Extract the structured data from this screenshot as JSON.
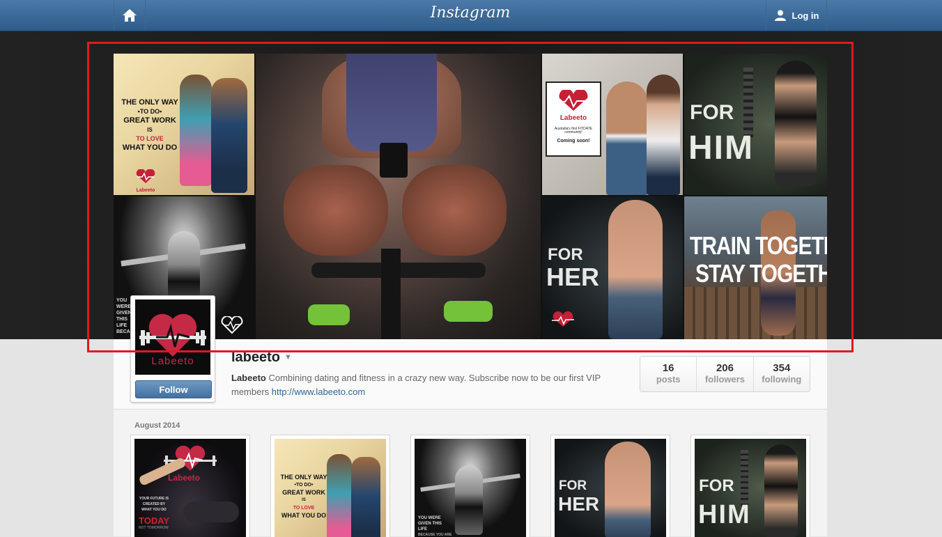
{
  "topbar": {
    "logo": "Instagram",
    "login_label": "Log in"
  },
  "mosaic": {
    "tile1": {
      "lines": [
        "THE ONLY WAY",
        "•TO DO•",
        "GREAT WORK",
        "IS",
        "TO LOVE",
        "WHAT YOU DO"
      ],
      "brand": "Labeeto"
    },
    "tile4": {
      "line1": "FOR",
      "line2": "HIM"
    },
    "tile5": {
      "line1": "FOR",
      "line2": "HER"
    },
    "tile6": {
      "line1": "TRAIN TOGETHER",
      "line2": "STAY TOGETHER"
    },
    "tile3": {
      "brand": "Labeeto",
      "tag": "Australia's first FITDATE community!",
      "soon": "Coming soon!"
    },
    "tile7": {
      "text": "YOU WERE GIVEN THIS LIFE BECAUSE YOU ARE STRONG"
    }
  },
  "profile": {
    "username": "labeeto",
    "avatar_brand": "Labeeto",
    "follow_label": "Follow",
    "bio_name": "Labeeto",
    "bio_text": " Combining dating and fitness in a crazy new way. Subscribe now to be our first VIP members ",
    "bio_link": "http://www.labeeto.com",
    "stats": [
      {
        "num": "16",
        "label": "posts"
      },
      {
        "num": "206",
        "label": "followers"
      },
      {
        "num": "354",
        "label": "following"
      }
    ]
  },
  "feed": {
    "month": "August 2014",
    "thumbs": [
      {
        "brand": "Labeeto",
        "quote": "YOUR FUTURE IS CREATED BY WHAT YOU DO",
        "today": "TODAY",
        "nt": "NOT TOMORROW"
      },
      {
        "lines": [
          "THE ONLY WAY",
          "•TO DO•",
          "GREAT WORK",
          "IS",
          "TO LOVE",
          "WHAT YOU DO"
        ]
      },
      {
        "text": "YOU WERE GIVEN THIS LIFE",
        "text2": "BECAUSE YOU ARE"
      },
      {
        "line1": "FOR",
        "line2": "HER"
      },
      {
        "line1": "FOR",
        "line2": "HIM"
      }
    ]
  },
  "colors": {
    "topbar": "#3a6894",
    "highlight": "#e0191e",
    "follow": "#4f7cab",
    "link": "#2d6599"
  }
}
